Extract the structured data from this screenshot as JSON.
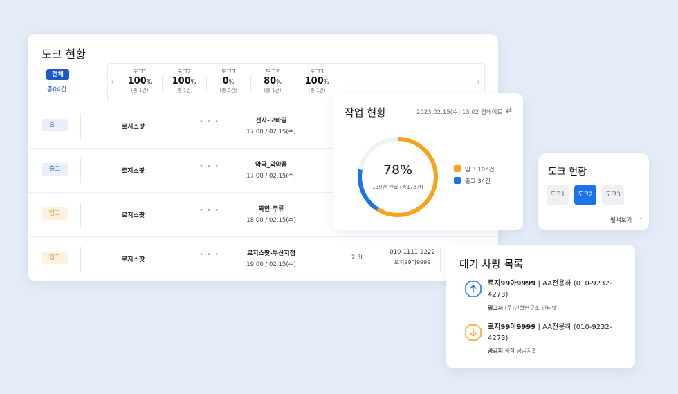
{
  "dock_status": {
    "title": "도크 현황",
    "all_label": "전체",
    "all_count": "총04건",
    "docks": [
      {
        "name": "도크1",
        "pct": "100",
        "unit": "%",
        "count": "(총 1건)"
      },
      {
        "name": "도크2",
        "pct": "100",
        "unit": "%",
        "count": "(총 1건)"
      },
      {
        "name": "도크3",
        "pct": "0",
        "unit": "%",
        "count": "(총 0건)"
      },
      {
        "name": "도크2",
        "pct": "80",
        "unit": "%",
        "count": "(총 1건)"
      },
      {
        "name": "도크3",
        "pct": "100",
        "unit": "%",
        "count": "(총 1건)"
      }
    ],
    "rows": [
      {
        "type": "출고",
        "company": "로지스팟",
        "cargo": "전자-모바일",
        "time": "17:00 / 02.15(수)"
      },
      {
        "type": "출고",
        "company": "로지스팟",
        "cargo": "약국_의약품",
        "time": "17:00 / 02.15(수)"
      },
      {
        "type": "입고",
        "company": "로지스팟",
        "cargo": "와인-주류",
        "time": "18:00 / 02.15(수)"
      },
      {
        "type": "입고",
        "company": "로지스팟",
        "cargo": "로지스팟-부산지점",
        "time": "19:00 / 02.15(수)",
        "weight": "2.5t",
        "phone": "010-1111-2222",
        "plate": "로지99아9999"
      }
    ]
  },
  "work_status": {
    "title": "작업 현황",
    "updated": "2023.02.15(수) 13:02 업데이트",
    "percent": "78%",
    "progress": 0.78,
    "summary": "139건 완료 (총178건)",
    "legend": [
      {
        "label": "입고 105건",
        "color": "#f7a21b"
      },
      {
        "label": "출고 34건",
        "color": "#1a73e8"
      }
    ]
  },
  "dock_mini": {
    "title": "도크 현황",
    "buttons": [
      "도크1",
      "도크2",
      "도크3"
    ],
    "active": 1,
    "expand_label": "펼쳐보기"
  },
  "waiting": {
    "title": "대기 차량 목록",
    "vehicles": [
      {
        "plate": "로지99아9999",
        "driver": " | AA전용하 (010-9232-4273)",
        "sub_label": "입고처",
        "sub_value": " (주)민철연구소-인터넷",
        "icon": "arrow-up-icon",
        "color": "#1a73e8"
      },
      {
        "plate": "로지99아9999",
        "driver": " | AA전용하 (010-9232-4273)",
        "sub_label": "공급처",
        "sub_value": " 용하 공급처2",
        "icon": "arrow-down-icon",
        "color": "#f7a21b"
      }
    ]
  }
}
